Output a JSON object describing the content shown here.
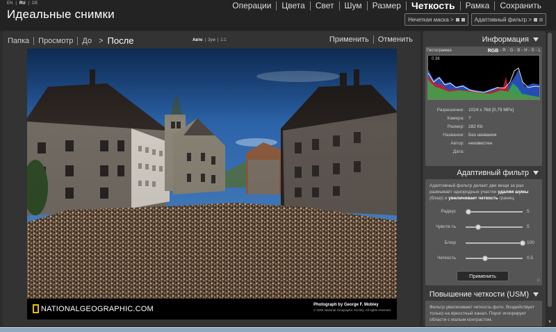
{
  "header": {
    "langs": [
      "EN",
      "RU",
      "DE"
    ],
    "active_lang": "RU",
    "brand": "Идеальные снимки",
    "menu": [
      "Операции",
      "Цвета",
      "Свет",
      "Шум",
      "Размер",
      "Четкость",
      "Рамка",
      "Сохранить"
    ],
    "active_menu": "Четкость",
    "submenu": [
      {
        "label": "Нечеткая маска >"
      },
      {
        "label": "Адаптивный фильтр >"
      }
    ]
  },
  "toolbar": {
    "crumbs": [
      "Папка",
      "Просмотр",
      "До"
    ],
    "current": "После",
    "zoom": [
      "Авто",
      "Зум",
      "1:1"
    ],
    "active_zoom": "Авто",
    "apply_label": "Применить",
    "cancel_label": "Отменить"
  },
  "photo": {
    "logo_text": "NATIONALGEOGRAPHIC.COM",
    "credit": "Photograph by George F. Mobley",
    "copyright": "© 2005 National Geographic Society. All rights reserved."
  },
  "info": {
    "title": "Информация",
    "histogram_label": "Гистограмма",
    "channels": [
      "RGB",
      "R",
      "G",
      "B",
      "H",
      "S",
      "L"
    ],
    "active_channel": "RGB",
    "hist_value": "0.36",
    "rows": [
      {
        "k": "Разрешение:",
        "v": "1024 x 768 [0,79 MPx]"
      },
      {
        "k": "Камера:",
        "v": "?"
      },
      {
        "k": "Размер:",
        "v": "282 Kb"
      },
      {
        "k": "Название:",
        "v": "Без названия"
      },
      {
        "k": "Автор:",
        "v": "неизвестен"
      },
      {
        "k": "Дата:",
        "v": ""
      }
    ]
  },
  "adaptive": {
    "title": "Адаптивный фильтр",
    "desc_html": "Адаптивный фильтр делает две вещи за раз: размывает однородные участки <b>удаляя шумы</b> (блюр) и <b>увеличивает четкость</b> границ.",
    "sliders": [
      {
        "label": "Радиус",
        "value": "5",
        "pos": 0.05
      },
      {
        "label": "Чувств-ть",
        "value": "5",
        "pos": 0.22
      },
      {
        "label": "Блюр",
        "value": "100",
        "pos": 1.0
      },
      {
        "label": "Четкость",
        "value": "0.5",
        "pos": 0.34
      }
    ],
    "apply_label": "Применить",
    "corner": "P"
  },
  "usm": {
    "title": "Повышение четкости (USM)",
    "desc": "Фильтр увеличивает четкость фото. Воздействует только на яркостный канал. Порог игнорирует области с малым контрастом."
  }
}
